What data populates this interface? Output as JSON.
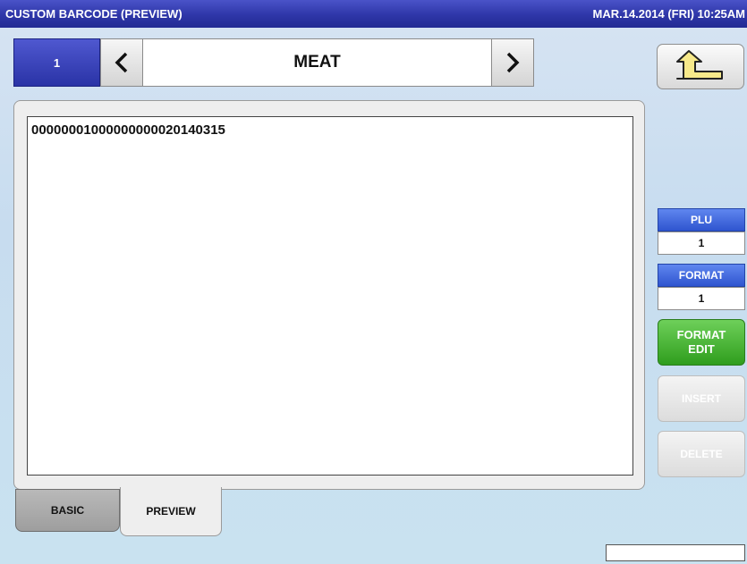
{
  "header": {
    "title": "CUSTOM BARCODE (PREVIEW)",
    "datetime": "MAR.14.2014 (FRI) 10:25AM"
  },
  "nav": {
    "number": "1",
    "category": "MEAT",
    "prev_icon": "chevron-left-icon",
    "next_icon": "chevron-right-icon",
    "back_icon": "return-arrow-icon"
  },
  "preview": {
    "text": "00000001000000000020140315"
  },
  "side": {
    "plu_label": "PLU",
    "plu_value": "1",
    "format_label": "FORMAT",
    "format_value": "1",
    "format_edit_line1": "FORMAT",
    "format_edit_line2": "EDIT",
    "insert_label": "INSERT",
    "delete_label": "DELETE"
  },
  "tabs": {
    "basic": "BASIC",
    "preview": "PREVIEW"
  },
  "status": {
    "value": ""
  },
  "colors": {
    "title_blue": "#2e36a8",
    "label_blue": "#2f55cf",
    "green": "#2f9d1d",
    "disabled": "#dcdcdc"
  }
}
